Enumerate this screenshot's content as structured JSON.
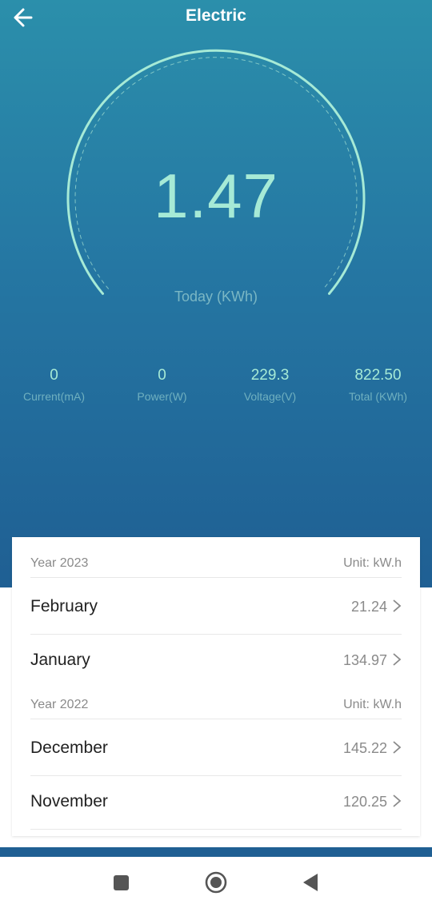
{
  "header": {
    "title": "Electric",
    "back_icon": "arrow-left-icon"
  },
  "gauge": {
    "value": "1.47",
    "label": "Today (KWh)"
  },
  "stats": [
    {
      "value": "0",
      "label": "Current(mA)"
    },
    {
      "value": "0",
      "label": "Power(W)"
    },
    {
      "value": "229.3",
      "label": "Voltage(V)"
    },
    {
      "value": "822.50",
      "label": "Total (KWh)"
    }
  ],
  "history": {
    "years": [
      {
        "title": "Year 2023",
        "unit": "Unit: kW.h",
        "months": [
          {
            "name": "February",
            "value": "21.24"
          },
          {
            "name": "January",
            "value": "134.97"
          }
        ]
      },
      {
        "title": "Year 2022",
        "unit": "Unit: kW.h",
        "months": [
          {
            "name": "December",
            "value": "145.22"
          },
          {
            "name": "November",
            "value": "120.25"
          }
        ]
      }
    ]
  },
  "navbar": {
    "icons": [
      "recents-square-icon",
      "home-circle-icon",
      "back-triangle-icon"
    ]
  },
  "colors": {
    "accent_mint": "#a6ead6",
    "hero_top": "#2b8fab",
    "hero_bottom": "#1f5f93"
  }
}
